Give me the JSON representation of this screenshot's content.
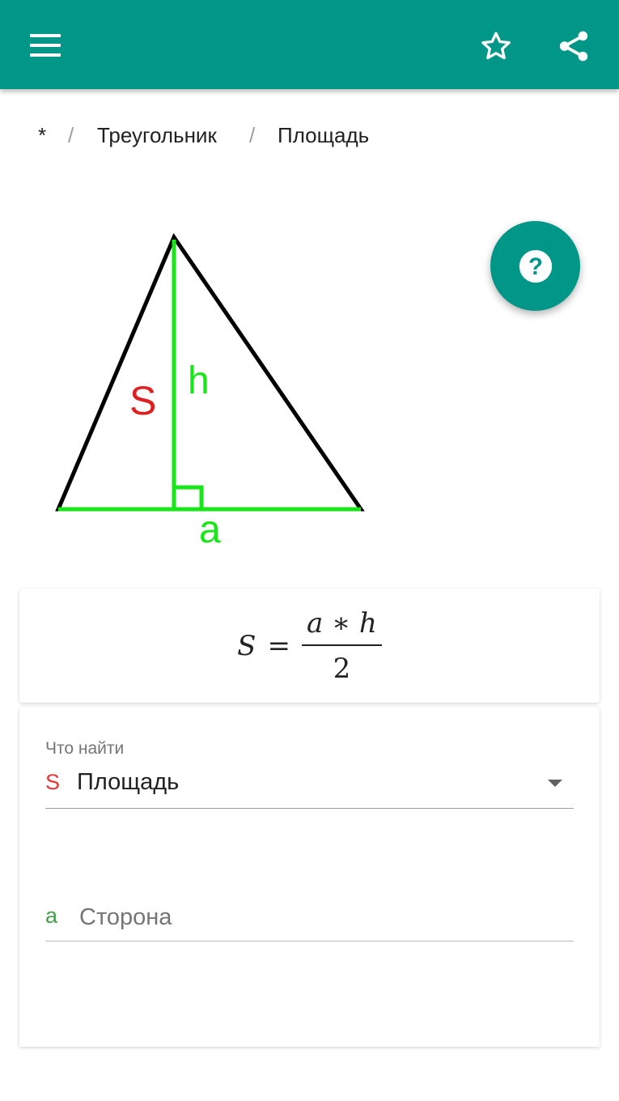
{
  "appbar": {
    "background": "#009688",
    "menu_icon": "menu-icon",
    "favorite_icon": "star-outline-icon",
    "share_icon": "share-icon"
  },
  "breadcrumb": {
    "root": "*",
    "separator": "/",
    "section": "Треугольник",
    "page": "Площадь"
  },
  "figure": {
    "area_label": "S",
    "height_label": "h",
    "base_label": "a",
    "colors": {
      "outline": "#000000",
      "highlight": "#19e619",
      "area": "#e02020"
    }
  },
  "help_button": {
    "icon": "help-circle-icon",
    "label": "?"
  },
  "formula": {
    "lhs": "S",
    "equals": "=",
    "numerator": "a ∗ h",
    "denominator": "2"
  },
  "form": {
    "find_label": "Что найти",
    "find_symbol": "S",
    "find_value": "Площадь",
    "side_symbol": "a",
    "side_placeholder": "Сторона",
    "side_value": ""
  }
}
